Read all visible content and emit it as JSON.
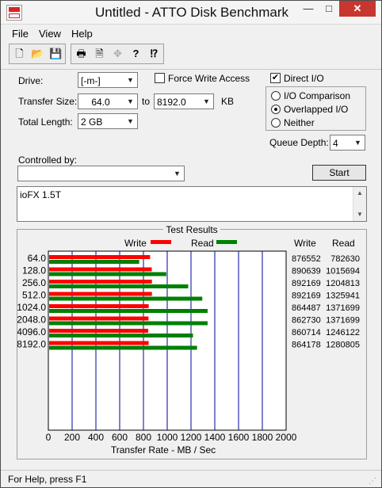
{
  "window": {
    "title": "Untitled - ATTO Disk Benchmark",
    "minimize": "—",
    "maximize": "□",
    "close": "✕"
  },
  "menu": [
    "File",
    "View",
    "Help"
  ],
  "toolbar": {
    "buttons": [
      "new-icon",
      "open-icon",
      "save-icon",
      "print-icon",
      "print-preview-icon",
      "move-icon",
      "help-icon",
      "context-help-icon"
    ],
    "glyphs": [
      "🗋",
      "📂",
      "💾",
      "🖶",
      "🗎",
      "✥",
      "?",
      "⁉"
    ]
  },
  "form": {
    "drive_label": "Drive:",
    "drive_value": "[-m-]",
    "force_write_label": "Force Write Access",
    "force_write_checked": false,
    "direct_io_label": "Direct I/O",
    "direct_io_checked": true,
    "transfer_size_label": "Transfer Size:",
    "transfer_from": "64.0",
    "to_label": "to",
    "transfer_to": "8192.0",
    "kb_label": "KB",
    "total_length_label": "Total Length:",
    "total_length_value": "2 GB",
    "io_options": [
      "I/O Comparison",
      "Overlapped I/O",
      "Neither"
    ],
    "io_selected": 1,
    "queue_depth_label": "Queue Depth:",
    "queue_depth_value": "4",
    "controlled_by_label": "Controlled by:",
    "controlled_by_value": "",
    "start_label": "Start",
    "description": "ioFX 1.5T"
  },
  "results": {
    "title": "Test Results",
    "write_legend": "Write",
    "read_legend": "Read",
    "write_header": "Write",
    "read_header": "Read",
    "colors": {
      "write": "#ff0000",
      "read": "#008000",
      "grid": "#0000a0"
    }
  },
  "chart_data": {
    "type": "bar",
    "categories": [
      "64.0",
      "128.0",
      "256.0",
      "512.0",
      "1024.0",
      "2048.0",
      "4096.0",
      "8192.0"
    ],
    "series": [
      {
        "name": "Write",
        "values": [
          876552,
          890639,
          892169,
          892169,
          864487,
          862730,
          860714,
          864178
        ]
      },
      {
        "name": "Read",
        "values": [
          782630,
          1015694,
          1204813,
          1325941,
          1371699,
          1371699,
          1246122,
          1280805
        ]
      }
    ],
    "xlabel": "Transfer Rate - MB / Sec",
    "xticks": [
      "0",
      "200",
      "400",
      "600",
      "800",
      "1000",
      "1200",
      "1400",
      "1600",
      "1800",
      "2000"
    ],
    "xlim": [
      0,
      2000
    ],
    "units_divisor": 1024
  },
  "status": {
    "text": "For Help, press F1"
  }
}
